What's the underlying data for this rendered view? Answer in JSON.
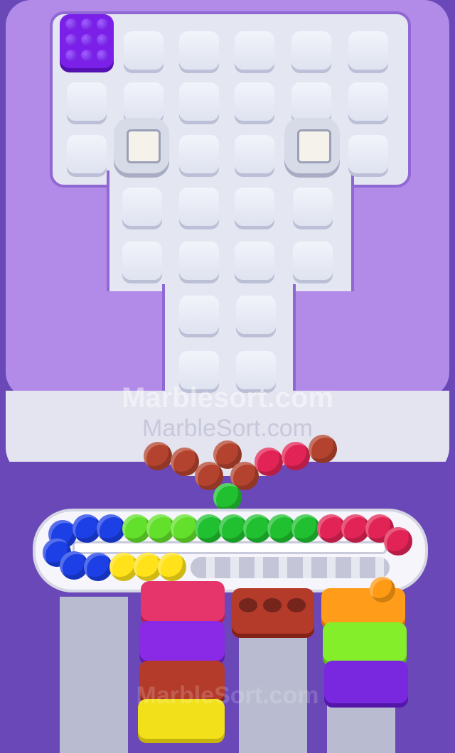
{
  "watermark": {
    "line1": "Marblesort.com",
    "line2": "MarbleSort.com",
    "line3": "MarbleSort.com"
  },
  "board": {
    "purple_block_color": "#7a20e8",
    "tile_color": "#eef0f8"
  },
  "marble_colors": {
    "brown": "#b3432e",
    "red": "#e22355",
    "green": "#20c030",
    "lime": "#62e02b",
    "blue": "#1c3fe6",
    "yellow": "#ffe21a",
    "orange": "#ff9a14"
  },
  "boxes": [
    {
      "name": "pink-box",
      "color": "#e5356a"
    },
    {
      "name": "purple-box",
      "color": "#8a2ae6"
    },
    {
      "name": "brown-box",
      "color": "#b43a2a"
    },
    {
      "name": "yellow-box",
      "color": "#f2e11a"
    },
    {
      "name": "orange-box",
      "color": "#ff9c1a"
    },
    {
      "name": "lime-box",
      "color": "#84ee2a"
    }
  ]
}
